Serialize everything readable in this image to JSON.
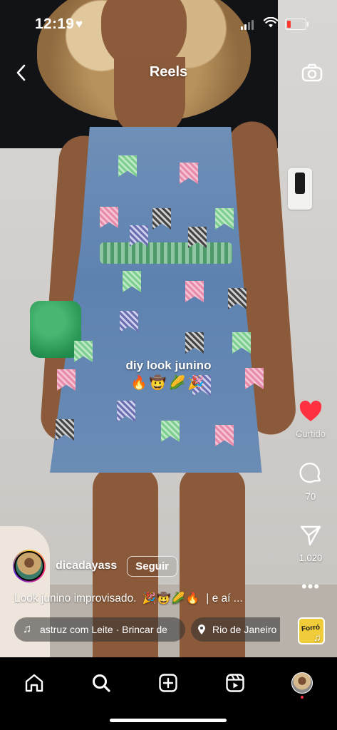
{
  "status_bar": {
    "time": "12:19",
    "battery_color": "#ff3b30"
  },
  "header": {
    "title": "Reels",
    "back_icon": "chevron-left-icon",
    "camera_icon": "camera-icon"
  },
  "video": {
    "overlay_text": "diy look junino",
    "overlay_emojis": "🔥🤠🌽🎉"
  },
  "actions": {
    "like": {
      "icon": "heart-filled-icon",
      "label": "Curtido",
      "color": "#ff3040"
    },
    "comment": {
      "icon": "comment-bubble-icon",
      "count": "70"
    },
    "share": {
      "icon": "paper-plane-icon",
      "count": "1.020"
    },
    "more": {
      "icon": "more-dots-icon",
      "glyph": "•••"
    }
  },
  "author": {
    "username": "dicadayass",
    "follow_label": "Seguir"
  },
  "caption": {
    "text": "Look junino improvisado.",
    "emojis": "🎉🤠🌽🔥",
    "tail": "| e aí ..."
  },
  "audio": {
    "label": "astruz com Leite · Brincar de",
    "thumb_text": "Forró"
  },
  "location": {
    "label": "Rio de Janeiro"
  },
  "nav": {
    "items": [
      "home-icon",
      "search-icon",
      "create-icon",
      "reels-icon",
      "profile-avatar"
    ]
  }
}
